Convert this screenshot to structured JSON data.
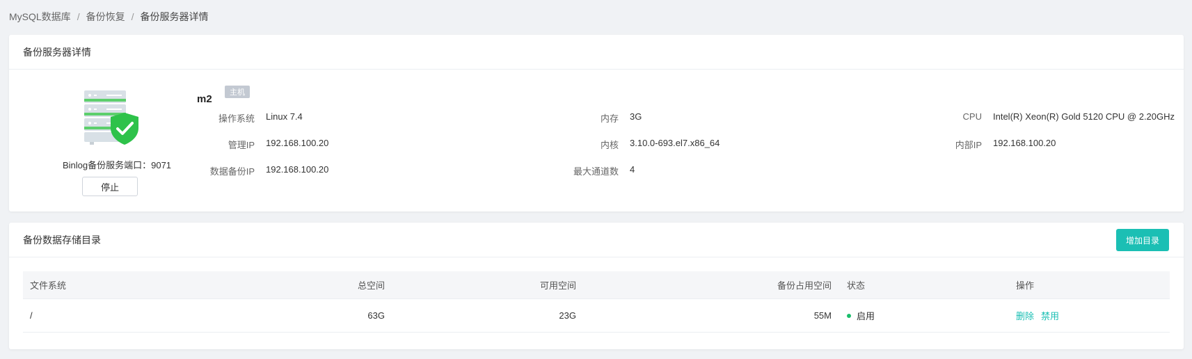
{
  "breadcrumb": [
    "MySQL数据库",
    "备份恢复",
    "备份服务器详情"
  ],
  "detail_card": {
    "title": "备份服务器详情",
    "port_label": "Binlog备份服务端口：",
    "port_value": "9071",
    "stop_button": "停止",
    "host_name": "m2",
    "host_tag": "主机",
    "fields": [
      {
        "label": "操作系统",
        "value": "Linux 7.4"
      },
      {
        "label": "管理IP",
        "value": "192.168.100.20"
      },
      {
        "label": "数据备份IP",
        "value": "192.168.100.20"
      },
      {
        "label": "内存",
        "value": "3G"
      },
      {
        "label": "内核",
        "value": "3.10.0-693.el7.x86_64"
      },
      {
        "label": "最大通道数",
        "value": "4"
      },
      {
        "label": "CPU",
        "value": "Intel(R) Xeon(R) Gold 5120 CPU @ 2.20GHz"
      },
      {
        "label": "内部IP",
        "value": "192.168.100.20"
      }
    ]
  },
  "storage_card": {
    "title": "备份数据存储目录",
    "add_button": "增加目录",
    "columns": [
      "文件系统",
      "总空间",
      "可用空间",
      "备份占用空间",
      "状态",
      "操作"
    ],
    "rows": [
      {
        "filesystem": "/",
        "total": "63G",
        "available": "23G",
        "backup_used": "55M",
        "status": "启用",
        "actions": [
          "删除",
          "禁用"
        ]
      }
    ]
  },
  "colors": {
    "accent": "#1bbfb4",
    "status_ok": "#19be6b",
    "shield": "#2ec24a",
    "server_body": "#d8e0e6"
  },
  "icons": [
    "server-shield-icon",
    "status-dot-icon"
  ]
}
